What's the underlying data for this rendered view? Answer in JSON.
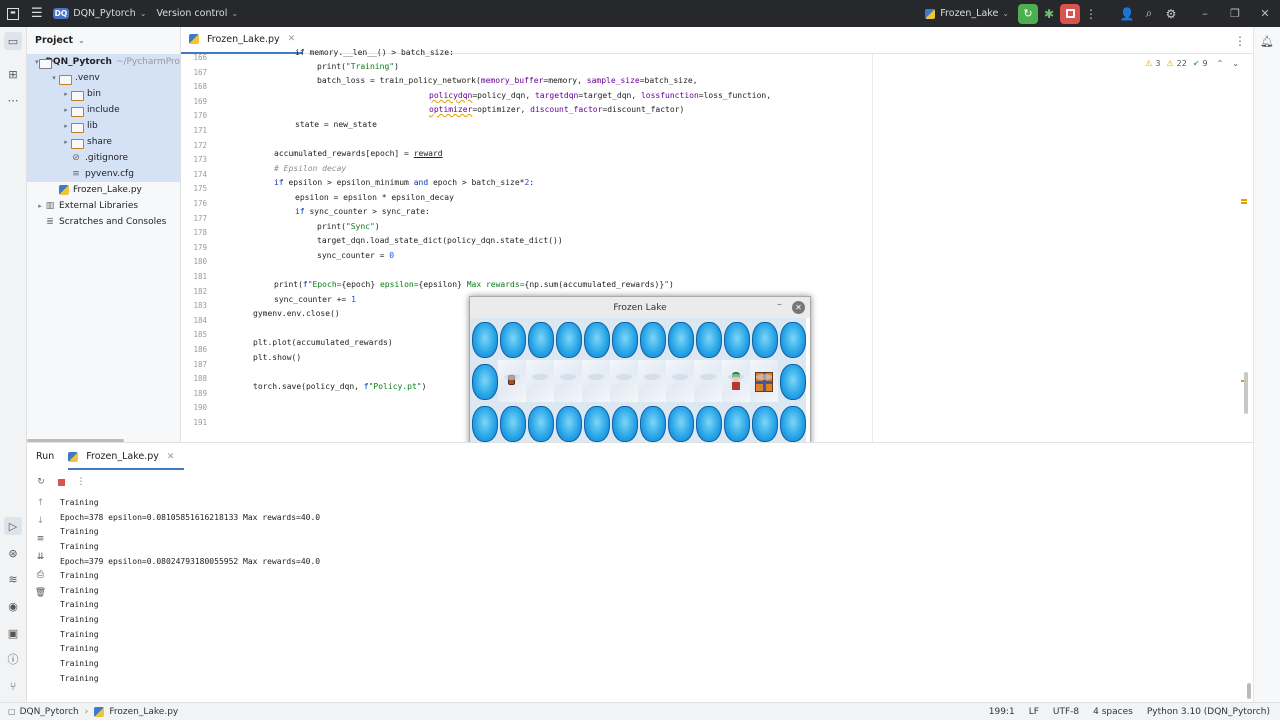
{
  "titlebar": {
    "project_badge": "DQ",
    "project_name": "DQN_Pytorch",
    "vcs": "Version control",
    "run_config": "Frozen_Lake"
  },
  "project_panel": {
    "title": "Project",
    "root_name": "DQN_Pytorch",
    "root_path": "~/PycharmPro",
    "items": [
      {
        "label": ".venv"
      },
      {
        "label": "bin"
      },
      {
        "label": "include"
      },
      {
        "label": "lib"
      },
      {
        "label": "share"
      },
      {
        "label": ".gitignore"
      },
      {
        "label": "pyvenv.cfg"
      },
      {
        "label": "Frozen_Lake.py"
      },
      {
        "label": "External Libraries"
      },
      {
        "label": "Scratches and Consoles"
      }
    ]
  },
  "editor": {
    "tab": "Frozen_Lake.py",
    "inspections": {
      "warnings": "3",
      "weak": "22",
      "ok": "9"
    },
    "line_numbers": [
      "166",
      "167",
      "168",
      "169",
      "170",
      "171",
      "172",
      "173",
      "174",
      "175",
      "176",
      "177",
      "178",
      "179",
      "180",
      "181",
      "182",
      "183",
      "184",
      "185",
      "186",
      "187",
      "188",
      "189",
      "190",
      "191"
    ],
    "partial_top_line": "if memory.__len__() > batch_size:"
  },
  "game": {
    "title": "Frozen Lake",
    "rows": [
      [
        "hole",
        "hole",
        "hole",
        "hole",
        "hole",
        "hole",
        "hole",
        "hole",
        "hole",
        "hole",
        "hole",
        "hole"
      ],
      [
        "hole",
        "start",
        "ice",
        "ice",
        "ice",
        "ice",
        "ice",
        "ice",
        "ice",
        "agent",
        "goal",
        "hole"
      ],
      [
        "hole",
        "hole",
        "hole",
        "hole",
        "hole",
        "hole",
        "hole",
        "hole",
        "hole",
        "hole",
        "hole",
        "hole"
      ]
    ]
  },
  "run": {
    "tab_run": "Run",
    "tab_file": "Frozen_Lake.py",
    "lines": [
      "Training",
      "Epoch=378 epsilon=0.08105851616218133 Max rewards=40.0",
      "Training",
      "Training",
      "Epoch=379 epsilon=0.08024793180055952 Max rewards=40.0",
      "Training",
      "Training",
      "Training",
      "Training",
      "Training",
      "Training",
      "Training",
      "Training"
    ]
  },
  "statusbar": {
    "project": "DQN_Pytorch",
    "file": "Frozen_Lake.py",
    "position": "199:1",
    "line_sep": "LF",
    "encoding": "UTF-8",
    "indent": "4 spaces",
    "interpreter": "Python 3.10 (DQN_Pytorch)"
  }
}
